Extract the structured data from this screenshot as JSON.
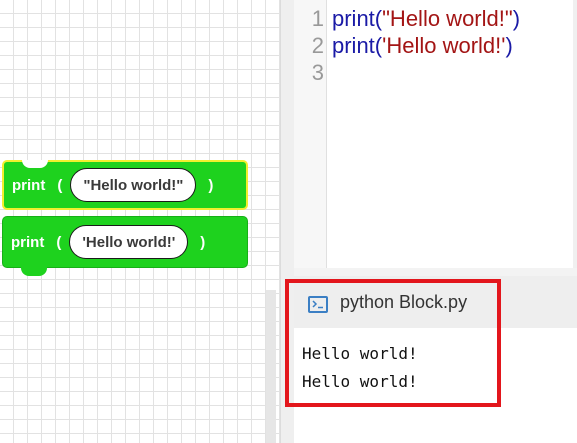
{
  "workspace": {
    "blocks": [
      {
        "keyword": "print",
        "open": "(",
        "arg": "\"Hello world!\"",
        "close": ")"
      },
      {
        "keyword": "print",
        "open": "(",
        "arg": "'Hello world!'",
        "close": ")"
      }
    ]
  },
  "editor": {
    "lines": [
      {
        "num": "1",
        "fn": "print",
        "open": "(",
        "str": "\"Hello world!\"",
        "close": ")"
      },
      {
        "num": "2",
        "fn": "print",
        "open": "(",
        "str": "'Hello world!'",
        "close": ")"
      },
      {
        "num": "3",
        "fn": "",
        "open": "",
        "str": "",
        "close": ""
      }
    ]
  },
  "output": {
    "title": "python Block.py",
    "icon": "terminal-icon",
    "lines": [
      "Hello world!",
      "Hello world!"
    ]
  },
  "colors": {
    "block_green": "#1ed21e",
    "selected_outline": "#f2ef2f",
    "highlight_red": "#e3161c",
    "keyword_blue": "#1a1aa6",
    "string_red": "#a31515"
  }
}
